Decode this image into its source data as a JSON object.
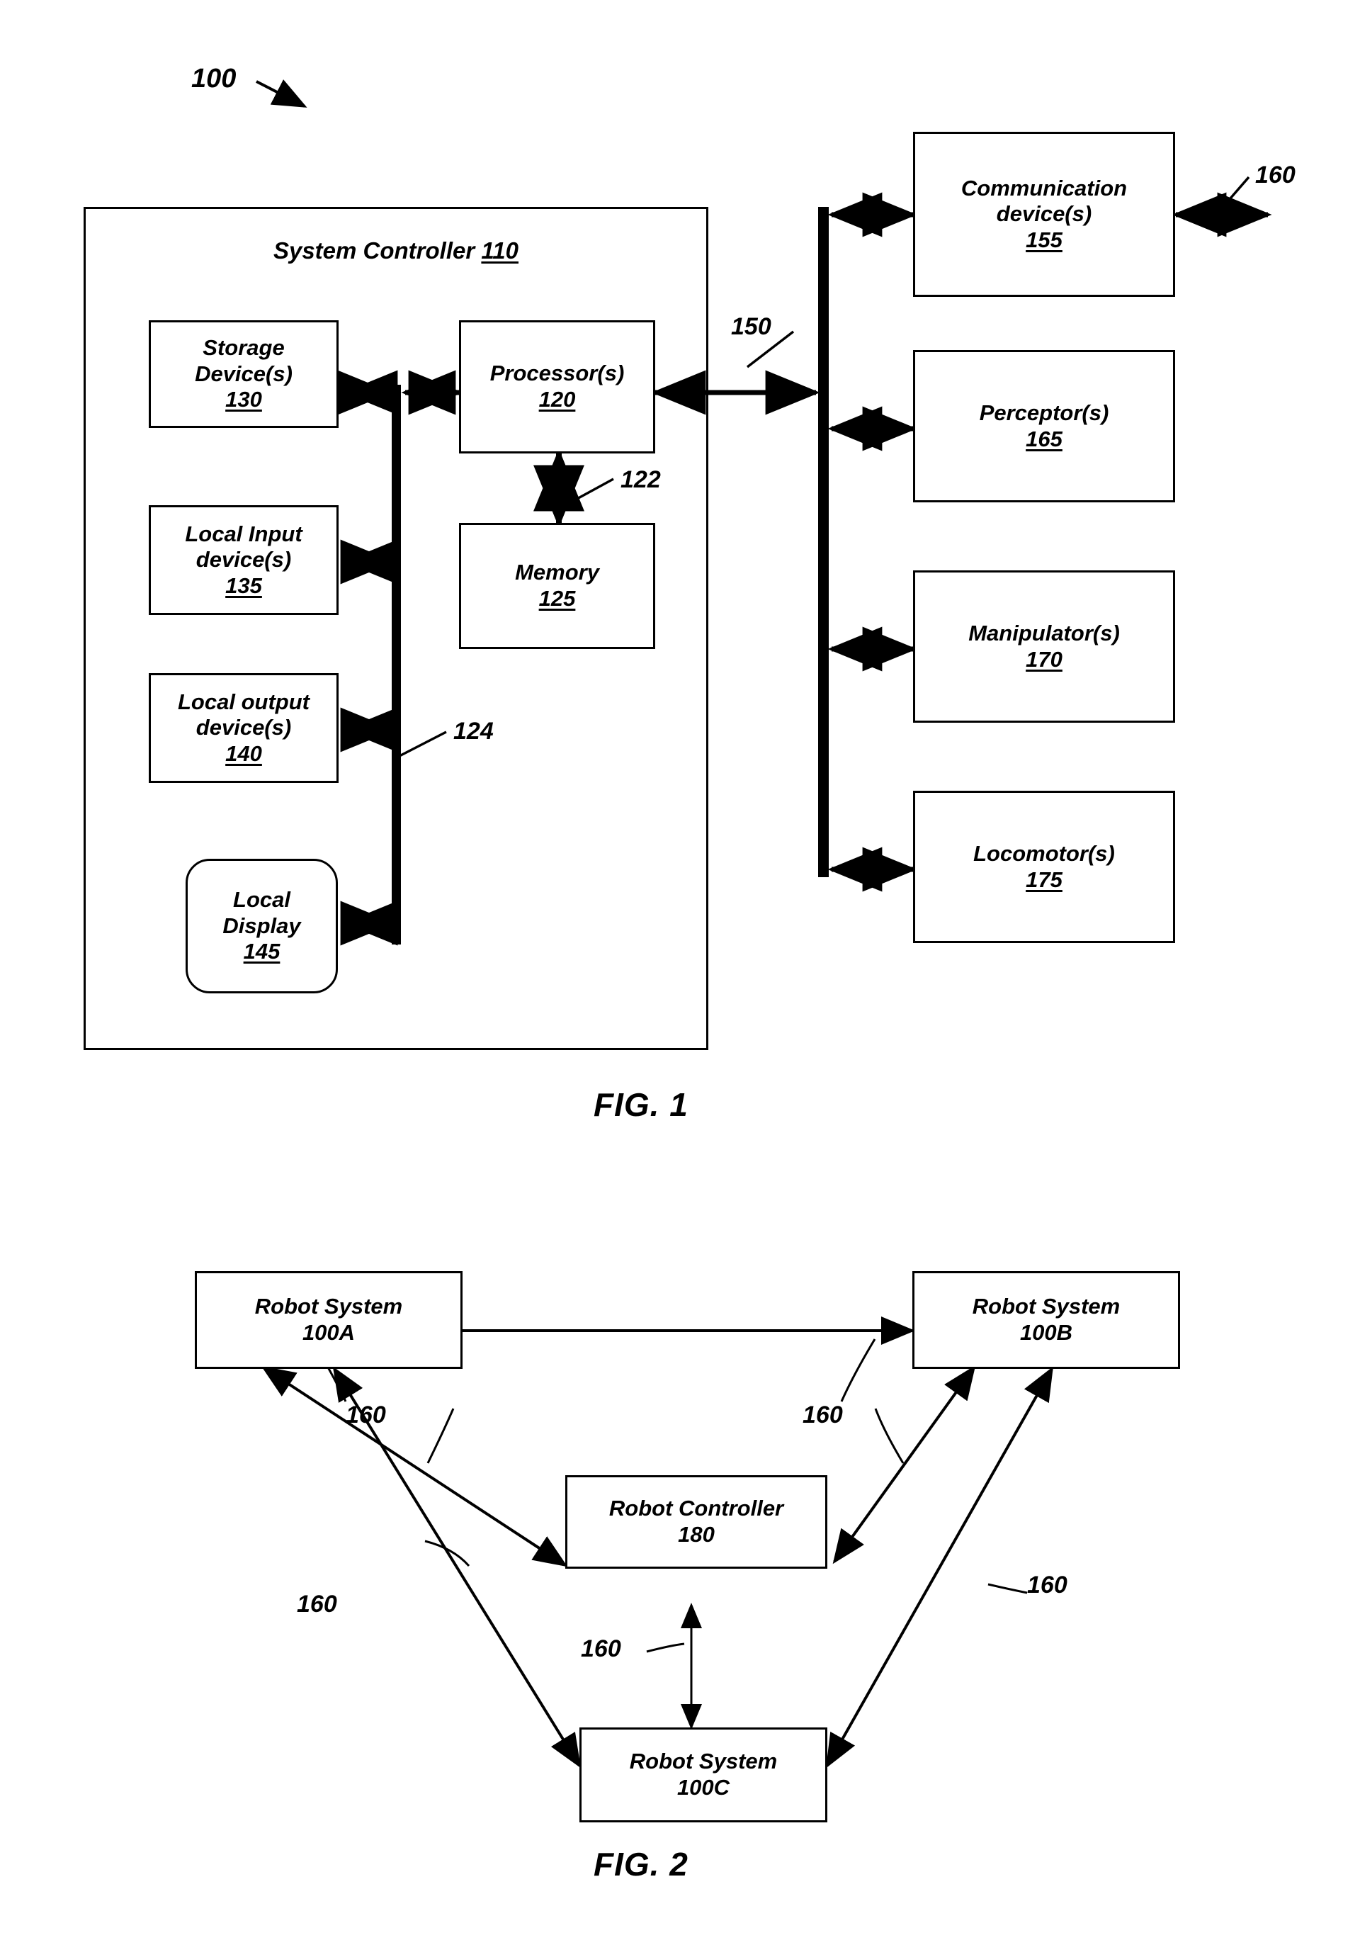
{
  "figure1": {
    "ref_tag": "100",
    "caption": "FIG. 1",
    "container": {
      "title": "System Controller",
      "number": "110"
    },
    "inner_blocks": [
      {
        "id": "storage",
        "lines": [
          "Storage",
          "Device(s)"
        ],
        "number": "130"
      },
      {
        "id": "local-input",
        "lines": [
          "Local Input",
          "device(s)"
        ],
        "number": "135"
      },
      {
        "id": "local-output",
        "lines": [
          "Local output",
          "device(s)"
        ],
        "number": "140"
      },
      {
        "id": "local-display",
        "lines": [
          "Local",
          "Display"
        ],
        "number": "145"
      },
      {
        "id": "processor",
        "lines": [
          "Processor(s)"
        ],
        "number": "120"
      },
      {
        "id": "memory",
        "lines": [
          "Memory"
        ],
        "number": "125"
      }
    ],
    "peripherals": [
      {
        "id": "communication",
        "lines": [
          "Communication",
          "device(s)"
        ],
        "number": "155"
      },
      {
        "id": "perceptor",
        "lines": [
          "Perceptor(s)"
        ],
        "number": "165"
      },
      {
        "id": "manipulator",
        "lines": [
          "Manipulator(s)"
        ],
        "number": "170"
      },
      {
        "id": "locomotor",
        "lines": [
          "Locomotor(s)"
        ],
        "number": "175"
      }
    ],
    "bus_labels": {
      "internal_bus": "124",
      "processor_memory_bus": "122",
      "system_bus": "150",
      "external_link": "160"
    }
  },
  "figure2": {
    "caption": "FIG. 2",
    "nodes": [
      {
        "id": "robot-system-a",
        "lines": [
          "Robot System"
        ],
        "number": "100A"
      },
      {
        "id": "robot-system-b",
        "lines": [
          "Robot System"
        ],
        "number": "100B"
      },
      {
        "id": "robot-controller",
        "lines": [
          "Robot Controller"
        ],
        "number": "180"
      },
      {
        "id": "robot-system-c",
        "lines": [
          "Robot System"
        ],
        "number": "100C"
      }
    ],
    "link_labels": [
      "160",
      "160",
      "160",
      "160",
      "160",
      "160"
    ]
  },
  "colors": {
    "ink": "#000000",
    "paper": "#ffffff"
  }
}
